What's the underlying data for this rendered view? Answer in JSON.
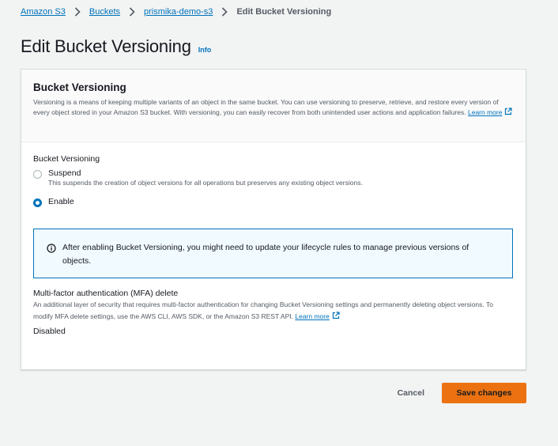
{
  "breadcrumb": {
    "items": [
      "Amazon S3",
      "Buckets",
      "prismika-demo-s3"
    ],
    "current": "Edit Bucket Versioning"
  },
  "page": {
    "title": "Edit Bucket Versioning",
    "info": "Info"
  },
  "panel": {
    "title": "Bucket Versioning",
    "description": "Versioning is a means of keeping multiple variants of an object in the same bucket. You can use versioning to preserve, retrieve, and restore every version of every object stored in your Amazon S3 bucket. With versioning, you can easily recover from both unintended user actions and application failures.",
    "learn_more": "Learn more"
  },
  "versioning": {
    "label": "Bucket Versioning",
    "options": [
      {
        "label": "Suspend",
        "description": "This suspends the creation of object versions for all operations but preserves any existing object versions.",
        "checked": false
      },
      {
        "label": "Enable",
        "description": "",
        "checked": true
      }
    ]
  },
  "alert": {
    "text": "After enabling Bucket Versioning, you might need to update your lifecycle rules to manage previous versions of objects."
  },
  "mfa": {
    "title": "Multi-factor authentication (MFA) delete",
    "description": "An additional layer of security that requires multi-factor authentication for changing Bucket Versioning settings and permanently deleting object versions. To modify MFA delete settings, use the AWS CLI, AWS SDK, or the Amazon S3 REST API.",
    "learn_more": "Learn more",
    "value": "Disabled"
  },
  "actions": {
    "cancel": "Cancel",
    "save": "Save changes"
  },
  "colors": {
    "link": "#0073bb",
    "primary_button": "#ec7211",
    "alert_border": "#0073bb",
    "alert_background": "#f1faff",
    "page_background": "#f2f3f3"
  },
  "icons": {
    "breadcrumb_separator": "chevron-right-icon",
    "external_link": "external-link-icon",
    "alert": "info-circle-icon"
  }
}
